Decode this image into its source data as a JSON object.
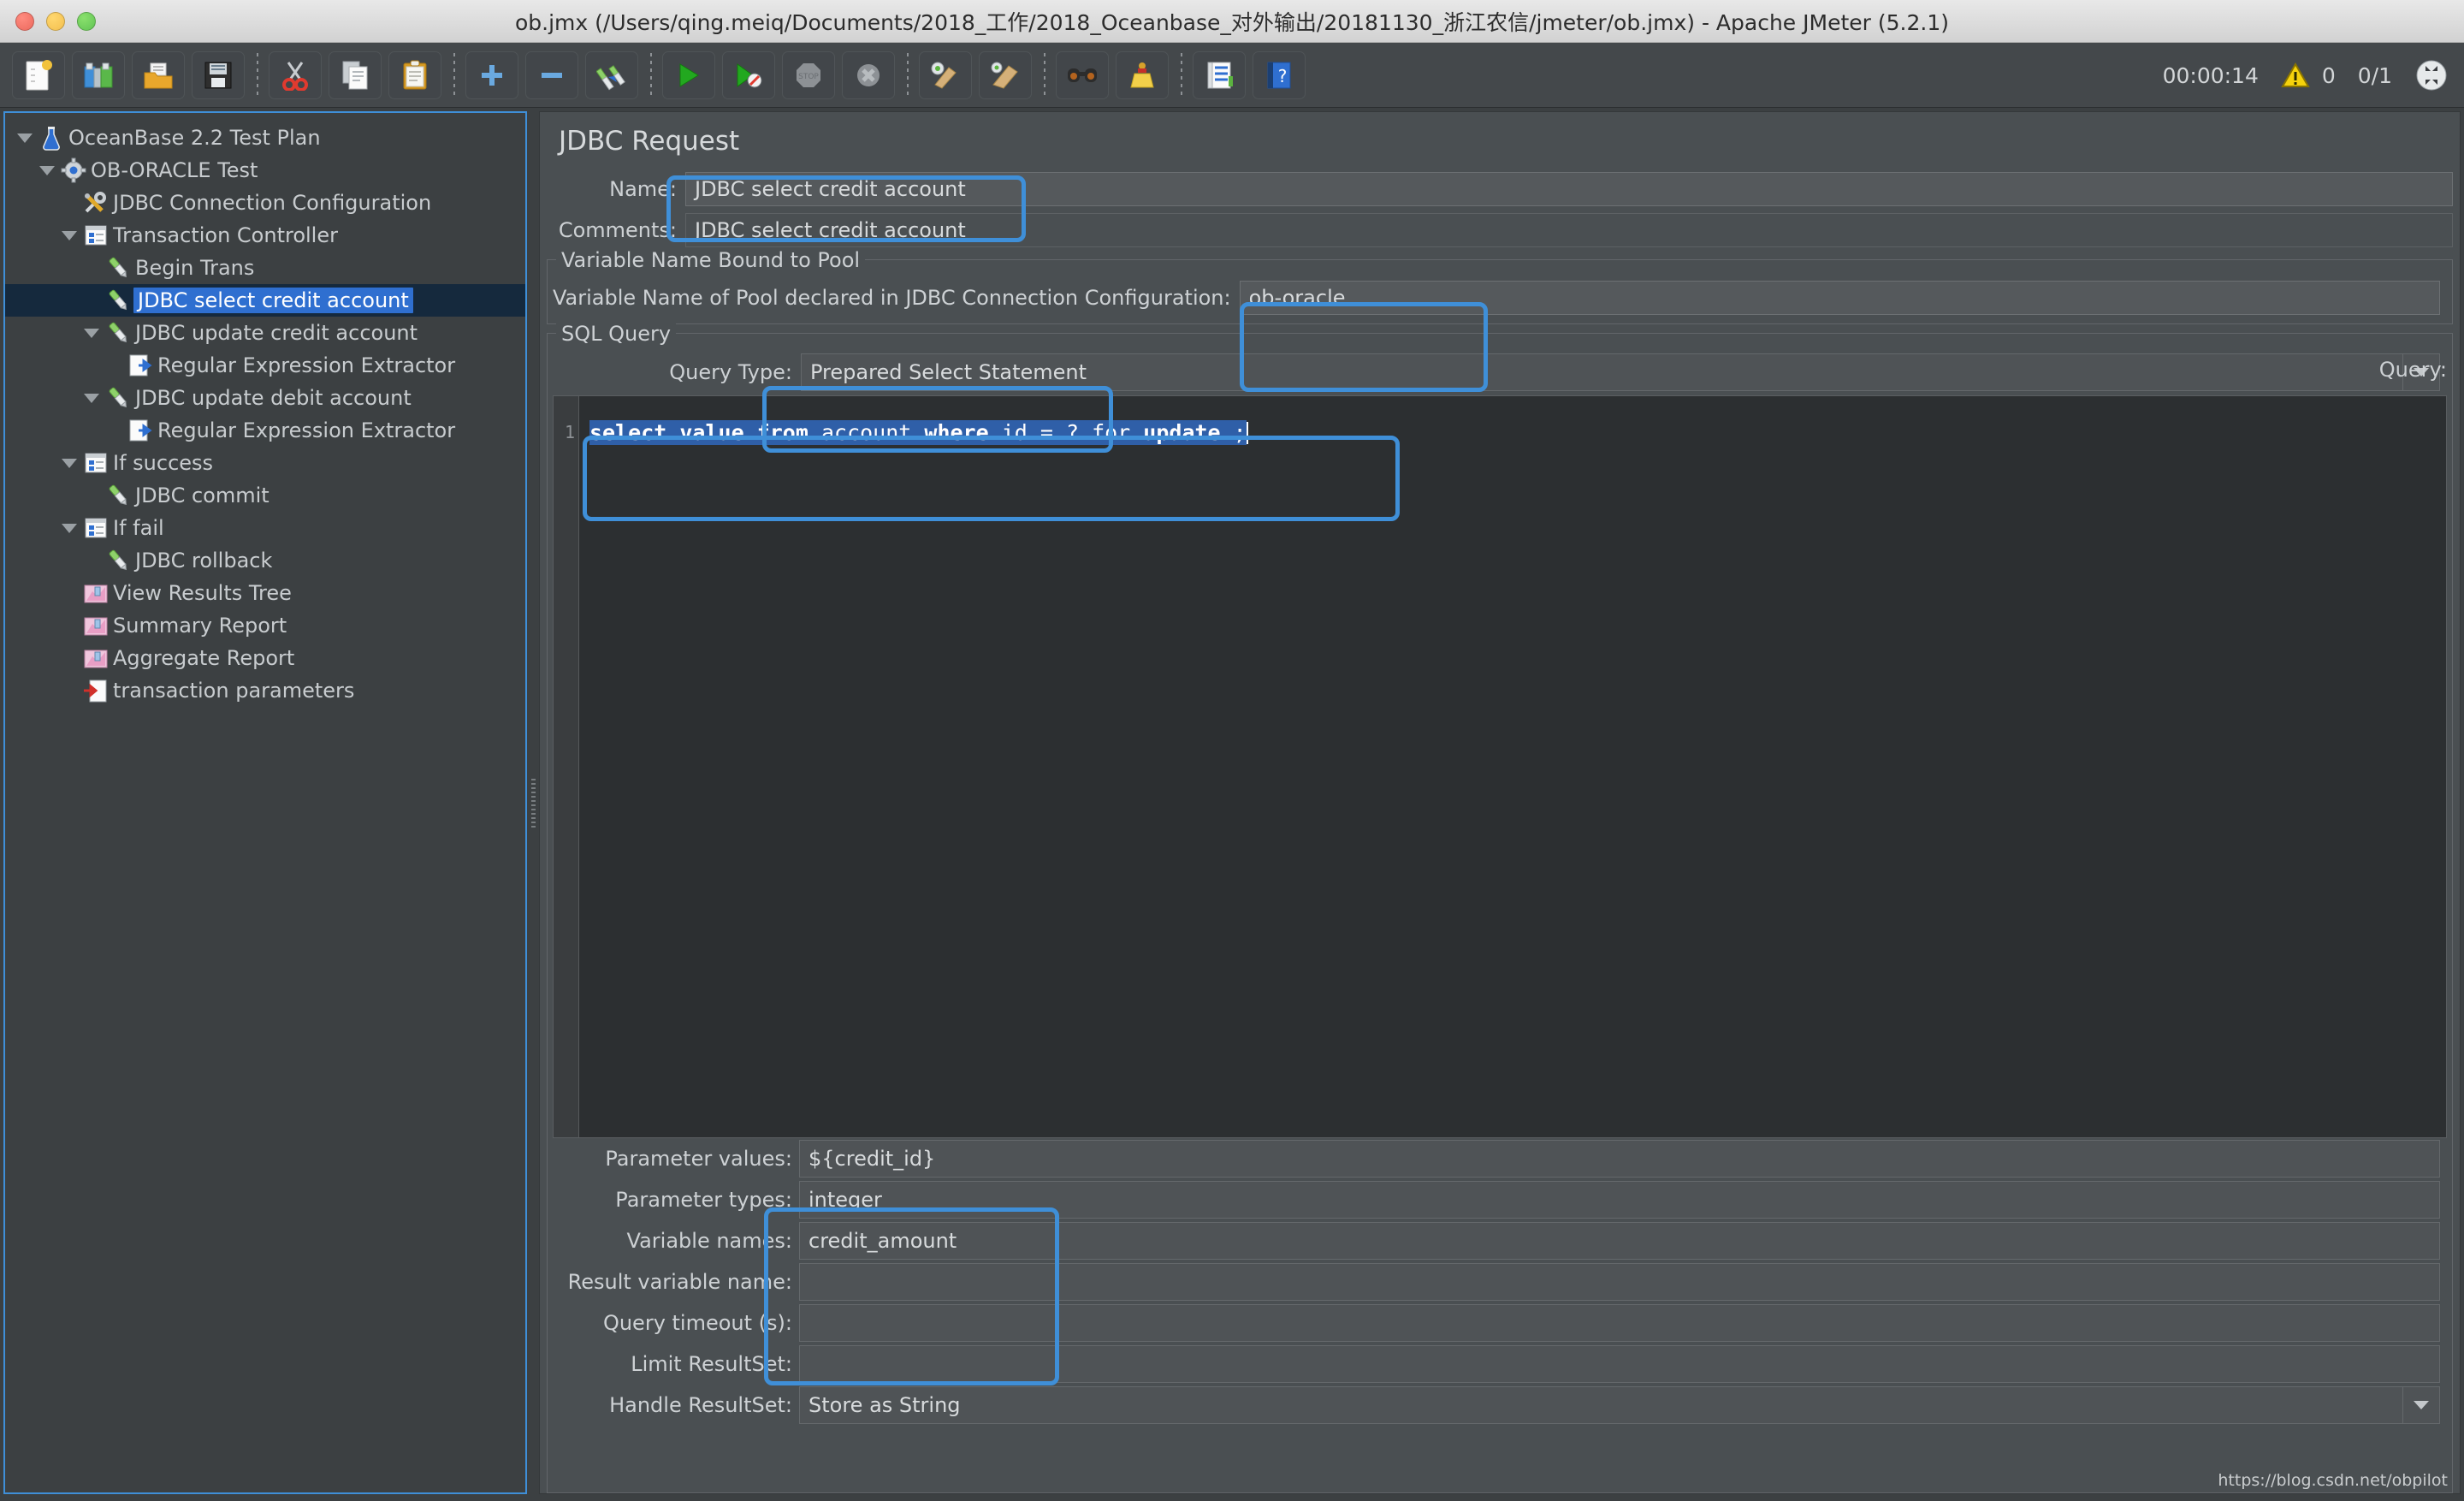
{
  "window": {
    "title": "ob.jmx (/Users/qing.meiq/Documents/2018_工作/2018_Oceanbase_对外输出/20181130_浙江农信/jmeter/ob.jmx) - Apache JMeter (5.2.1)"
  },
  "toolbar": {
    "buttons": [
      {
        "name": "new-icon",
        "label": "New"
      },
      {
        "name": "templates-icon",
        "label": "Templates"
      },
      {
        "name": "open-icon",
        "label": "Open"
      },
      {
        "name": "save-icon",
        "label": "Save"
      },
      {
        "name": "cut-icon",
        "label": "Cut"
      },
      {
        "name": "copy-icon",
        "label": "Copy"
      },
      {
        "name": "paste-icon",
        "label": "Paste"
      },
      {
        "name": "expand-icon",
        "label": "Expand All"
      },
      {
        "name": "collapse-icon",
        "label": "Collapse All"
      },
      {
        "name": "toggle-icon",
        "label": "Toggle"
      },
      {
        "name": "start-icon",
        "label": "Start"
      },
      {
        "name": "start-no-pauses-icon",
        "label": "Start no pauses"
      },
      {
        "name": "stop-icon",
        "label": "Stop"
      },
      {
        "name": "shutdown-icon",
        "label": "Shutdown"
      },
      {
        "name": "clear-icon",
        "label": "Clear"
      },
      {
        "name": "clear-all-icon",
        "label": "Clear All"
      },
      {
        "name": "search-icon",
        "label": "Search"
      },
      {
        "name": "reset-search-icon",
        "label": "Reset Search"
      },
      {
        "name": "function-helper-icon",
        "label": "Function Helper Dialog"
      },
      {
        "name": "help-icon",
        "label": "Help"
      }
    ],
    "elapsed_time": "00:00:14",
    "warning_count": "0",
    "thread_count": "0/1",
    "warning_icon": "warning-triangle-icon",
    "threads_icon": "threads-status-icon"
  },
  "tree": {
    "items": [
      {
        "label": "OceanBase 2.2 Test Plan",
        "indent": 0,
        "arrow": "down",
        "icon": "test-plan-icon",
        "selected": false
      },
      {
        "label": "OB-ORACLE Test",
        "indent": 1,
        "arrow": "down",
        "icon": "thread-group-icon",
        "selected": false
      },
      {
        "label": "JDBC Connection Configuration",
        "indent": 2,
        "arrow": "none",
        "icon": "config-element-icon",
        "selected": false
      },
      {
        "label": "Transaction Controller",
        "indent": 2,
        "arrow": "down",
        "icon": "controller-icon",
        "selected": false
      },
      {
        "label": "Begin Trans",
        "indent": 3,
        "arrow": "none",
        "icon": "sampler-icon",
        "selected": false
      },
      {
        "label": "JDBC select credit account",
        "indent": 3,
        "arrow": "none",
        "icon": "sampler-icon",
        "selected": true
      },
      {
        "label": "JDBC update credit account",
        "indent": 3,
        "arrow": "down",
        "icon": "sampler-icon",
        "selected": false
      },
      {
        "label": "Regular Expression Extractor",
        "indent": 4,
        "arrow": "none",
        "icon": "post-processor-icon",
        "selected": false
      },
      {
        "label": "JDBC update debit account",
        "indent": 3,
        "arrow": "down",
        "icon": "sampler-icon",
        "selected": false
      },
      {
        "label": "Regular Expression Extractor",
        "indent": 4,
        "arrow": "none",
        "icon": "post-processor-icon",
        "selected": false
      },
      {
        "label": "If success",
        "indent": 2,
        "arrow": "down",
        "icon": "controller-icon",
        "selected": false
      },
      {
        "label": "JDBC commit",
        "indent": 3,
        "arrow": "none",
        "icon": "sampler-icon",
        "selected": false
      },
      {
        "label": "If fail",
        "indent": 2,
        "arrow": "down",
        "icon": "controller-icon",
        "selected": false
      },
      {
        "label": "JDBC rollback",
        "indent": 3,
        "arrow": "none",
        "icon": "sampler-icon",
        "selected": false
      },
      {
        "label": "View Results Tree",
        "indent": 2,
        "arrow": "none",
        "icon": "listener-icon",
        "selected": false
      },
      {
        "label": "Summary Report",
        "indent": 2,
        "arrow": "none",
        "icon": "listener-icon",
        "selected": false
      },
      {
        "label": "Aggregate Report",
        "indent": 2,
        "arrow": "none",
        "icon": "listener-icon",
        "selected": false
      },
      {
        "label": "transaction parameters",
        "indent": 2,
        "arrow": "none",
        "icon": "csv-data-set-icon",
        "selected": false
      }
    ]
  },
  "main": {
    "panel_title": "JDBC Request",
    "name_label": "Name:",
    "name_value": "JDBC select credit account",
    "comments_label": "Comments:",
    "comments_value": "JDBC select credit account",
    "pool_group_legend": "Variable Name Bound to Pool",
    "pool_label": "Variable Name of Pool declared in JDBC Connection Configuration:",
    "pool_value": "ob-oracle",
    "sql_group_legend": "SQL Query",
    "query_type_label": "Query Type:",
    "query_type_value": "Prepared Select Statement",
    "query_label": "Query:",
    "query_line_number": "1",
    "query_sql": "select value from account where id = ? for update ;",
    "query_sql_tokens": [
      {
        "t": "select",
        "kw": true
      },
      {
        "t": " ",
        "kw": false
      },
      {
        "t": "value",
        "kw": true
      },
      {
        "t": " ",
        "kw": false
      },
      {
        "t": "from",
        "kw": true
      },
      {
        "t": " account ",
        "kw": false
      },
      {
        "t": "where",
        "kw": true
      },
      {
        "t": " id = ? ",
        "kw": false
      },
      {
        "t": "for",
        "kw": false
      },
      {
        "t": " ",
        "kw": false
      },
      {
        "t": "update",
        "kw": true
      },
      {
        "t": " ;",
        "kw": false
      }
    ],
    "fields": [
      {
        "label": "Parameter values:",
        "value": "${credit_id}",
        "type": "text"
      },
      {
        "label": "Parameter types:",
        "value": "integer",
        "type": "text"
      },
      {
        "label": "Variable names:",
        "value": "credit_amount",
        "type": "text"
      },
      {
        "label": "Result variable name:",
        "value": "",
        "type": "text"
      },
      {
        "label": "Query timeout (s):",
        "value": "",
        "type": "text"
      },
      {
        "label": "Limit ResultSet:",
        "value": "",
        "type": "text"
      },
      {
        "label": "Handle ResultSet:",
        "value": "Store as String",
        "type": "combo"
      }
    ]
  },
  "watermark": "https://blog.csdn.net/obpilot",
  "colors": {
    "accent": "#3f8fd8",
    "selection": "#2f6fd0",
    "panel_bg": "#4a4f52",
    "tree_bg": "#3c4042",
    "editor_bg": "#2c2f31"
  }
}
